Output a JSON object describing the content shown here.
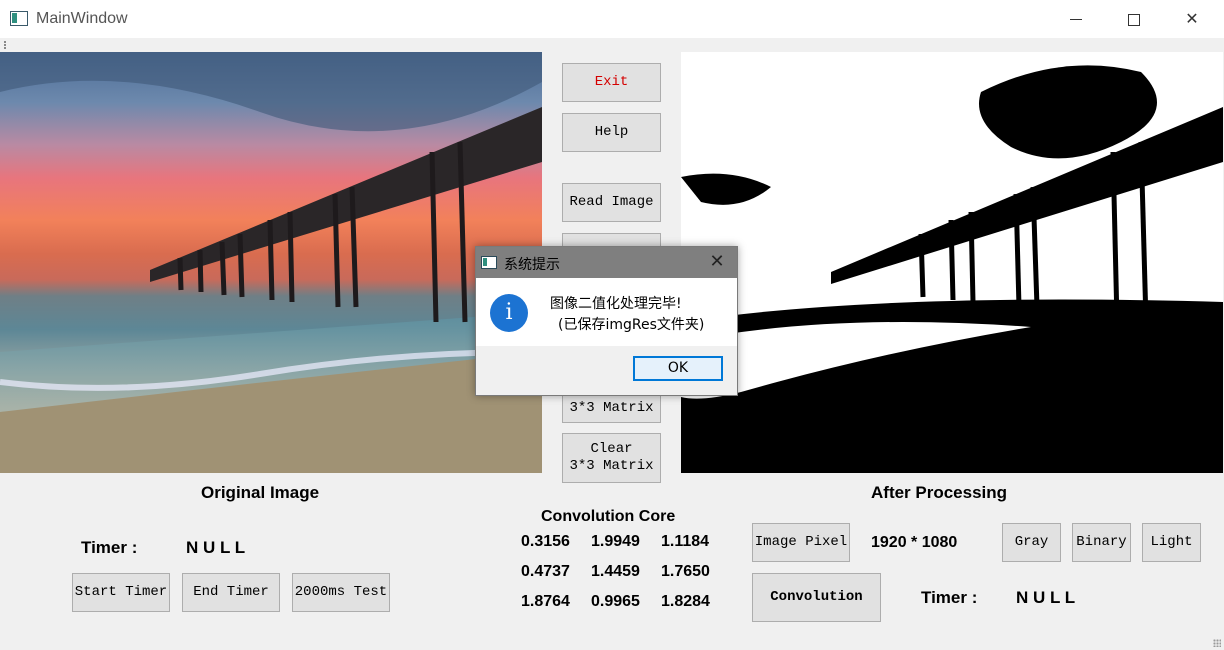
{
  "window": {
    "title": "MainWindow"
  },
  "images": {
    "original_alt": "beach pier at sunset",
    "processed_alt": "binarized beach pier"
  },
  "sidebar": {
    "exit": "Exit",
    "help": "Help",
    "read_image": "Read Image",
    "matrix": "3*3 Matrix",
    "clear_line1": "Clear",
    "clear_line2": "3*3 Matrix"
  },
  "left_panel": {
    "title": "Original Image",
    "timer_label": "Timer :",
    "timer_value": "N U L L",
    "start_timer": "Start Timer",
    "end_timer": "End Timer",
    "test_2000": "2000ms Test"
  },
  "convolution": {
    "title": "Convolution Core",
    "matrix": [
      [
        "0.3156",
        "1.9949",
        "1.1184"
      ],
      [
        "0.4737",
        "1.4459",
        "1.7650"
      ],
      [
        "1.8764",
        "0.9965",
        "1.8284"
      ]
    ]
  },
  "right_panel": {
    "title": "After Processing",
    "image_pixel": "Image Pixel",
    "resolution": "1920 * 1080",
    "gray": "Gray",
    "binary": "Binary",
    "light": "Light",
    "convolution": "Convolution",
    "timer_label": "Timer :",
    "timer_value": "N U L L"
  },
  "dialog": {
    "title": "系统提示",
    "message_line1": "图像二值化处理完毕!",
    "message_line2": "(已保存imgRes文件夹)",
    "ok": "OK",
    "icon": "info-icon"
  },
  "colors": {
    "exit_text": "#d40000",
    "dialog_titlebar": "#7f7f7f",
    "ok_border": "#0078d7",
    "info_icon": "#1c73d2"
  }
}
